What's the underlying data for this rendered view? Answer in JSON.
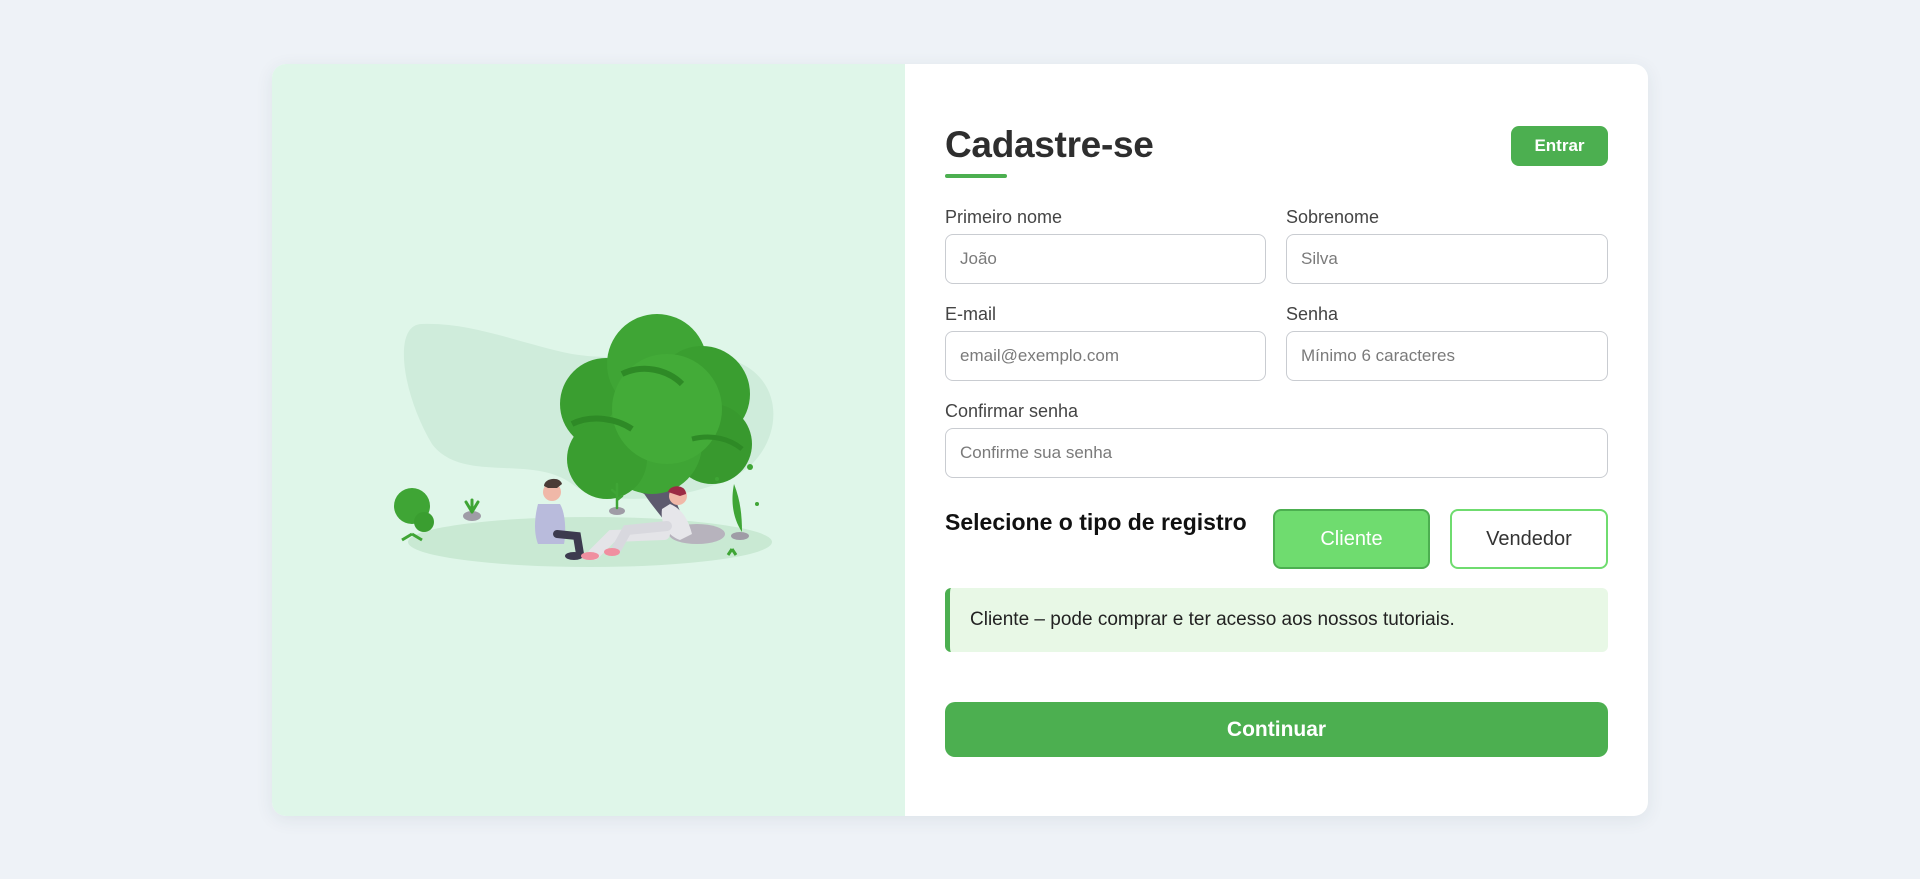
{
  "header": {
    "title": "Cadastre-se",
    "login_label": "Entrar"
  },
  "form": {
    "first_name": {
      "label": "Primeiro nome",
      "placeholder": "João",
      "value": ""
    },
    "last_name": {
      "label": "Sobrenome",
      "placeholder": "Silva",
      "value": ""
    },
    "email": {
      "label": "E-mail",
      "placeholder": "email@exemplo.com",
      "value": ""
    },
    "password": {
      "label": "Senha",
      "placeholder": "Mínimo 6 caracteres",
      "value": ""
    },
    "confirm_password": {
      "label": "Confirmar senha",
      "placeholder": "Confirme sua senha",
      "value": ""
    }
  },
  "registration_type": {
    "label": "Selecione o tipo de registro",
    "options": [
      {
        "label": "Cliente",
        "selected": true
      },
      {
        "label": "Vendedor",
        "selected": false
      }
    ],
    "description": "Cliente – pode comprar e ter acesso aos nossos tutoriais."
  },
  "submit": {
    "label": "Continuar"
  },
  "illustration": {
    "icon": "people-under-tree-illustration"
  },
  "colors": {
    "accent": "#4caf50",
    "selected_option": "#6fdc6f",
    "illustration_bg": "#dff6e9",
    "info_bg": "#e8f8e6",
    "page_bg": "#eef2f7"
  }
}
